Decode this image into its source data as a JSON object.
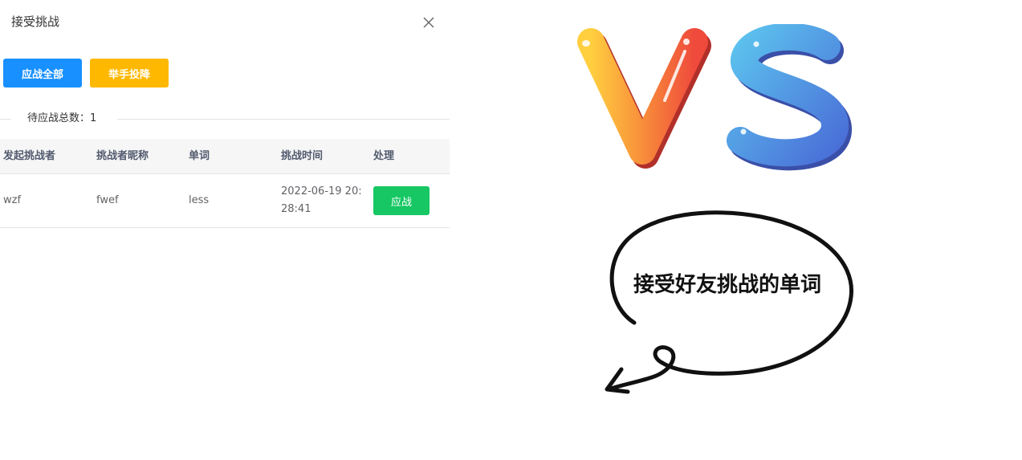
{
  "dialog": {
    "title": "接受挑战",
    "close_icon": "close-icon",
    "buttons": {
      "accept_all": "应战全部",
      "surrender": "举手投降"
    },
    "pending_label": "待应战总数：1"
  },
  "table": {
    "headers": [
      "发起挑战者",
      "挑战者昵称",
      "单词",
      "挑战时间",
      "处理"
    ],
    "rows": [
      {
        "challenger": "wzf",
        "nickname": "fwef",
        "word": "less",
        "time": "2022-06-19 20:28:41",
        "action": "应战"
      }
    ]
  },
  "illustration": {
    "vs_text": "VS",
    "bubble_text": "接受好友挑战的单词"
  },
  "colors": {
    "primary": "#1890ff",
    "warning": "#ffb800",
    "success": "#16c763"
  }
}
